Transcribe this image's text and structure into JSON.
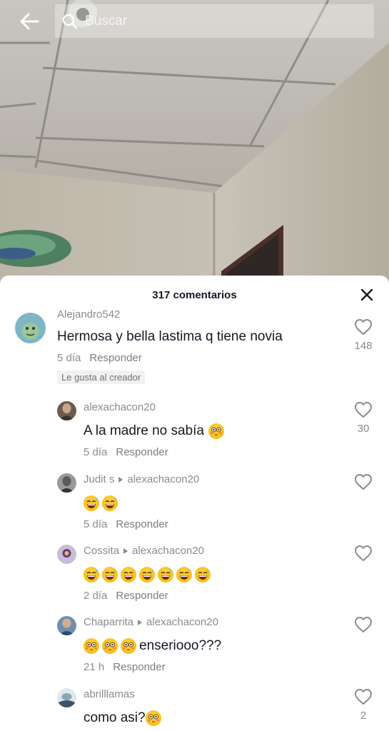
{
  "search": {
    "placeholder": "Buscar"
  },
  "sheet": {
    "comment_count": "317 comentarios"
  },
  "colors": {
    "text": "#161823",
    "muted": "#8a8b91",
    "sheet_bg": "#ffffff",
    "emoji": "#f5b400"
  },
  "icons": {
    "back": "back-arrow-icon",
    "search": "search-icon",
    "close": "close-icon",
    "like": "heart-outline-icon",
    "emoji_flushed": "flushed-face-emoji",
    "emoji_grin": "grinning-sweat-emoji"
  },
  "comments": [
    {
      "username": "Alejandro542",
      "text": "Hermosa y bella lastima q tiene novia",
      "time": "5 día",
      "reply_label": "Responder",
      "badge": "Le gusta al creador",
      "likes": "148"
    },
    {
      "username": "alexachacon20",
      "text": "A la madre no sabía",
      "emojis_after": [
        "flushed"
      ],
      "time": "5 día",
      "reply_label": "Responder",
      "likes": "30"
    },
    {
      "username": "Judit s",
      "reply_to": "alexachacon20",
      "text": "",
      "emojis_before": [
        "grin",
        "grin"
      ],
      "time": "5 día",
      "reply_label": "Responder",
      "likes": ""
    },
    {
      "username": "Cossita",
      "reply_to": "alexachacon20",
      "text": "",
      "emojis_before": [
        "grin",
        "grin",
        "grin",
        "grin",
        "grin",
        "grin",
        "grin"
      ],
      "time": "2 día",
      "reply_label": "Responder",
      "likes": ""
    },
    {
      "username": "Chaparrita",
      "reply_to": "alexachacon20",
      "text": "enseriooo???",
      "emojis_before": [
        "flushed",
        "flushed",
        "flushed"
      ],
      "time": "21 h",
      "reply_label": "Responder",
      "likes": ""
    },
    {
      "username": "abrilllamas",
      "text": "como asi?",
      "emojis_after": [
        "flushed"
      ],
      "time": "",
      "reply_label": "",
      "likes": "2"
    }
  ]
}
